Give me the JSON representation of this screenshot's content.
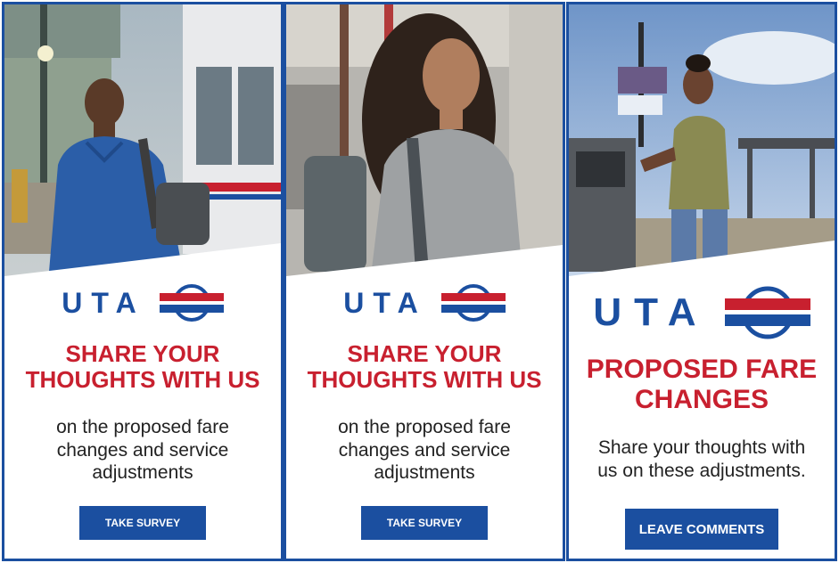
{
  "brand": {
    "logo_text": "UTA",
    "colors": {
      "blue": "#1b4fa0",
      "red": "#c8202f"
    }
  },
  "banners": [
    {
      "headline_line1": "Share your",
      "headline_line2": "thoughts with us",
      "body_line1": "on the proposed fare",
      "body_line2": "changes and service",
      "body_line3": "adjustments",
      "cta_label": "Take Survey"
    },
    {
      "headline_line1": "Share your",
      "headline_line2": "thoughts with us",
      "body_line1": "on the proposed fare",
      "body_line2": "changes and service",
      "body_line3": "adjustments",
      "cta_label": "Take Survey"
    },
    {
      "headline_line1": "Proposed fare",
      "headline_line2": "changes",
      "body_line1": "Share your thoughts with",
      "body_line2": "us on these adjustments.",
      "cta_label": "Leave Comments"
    }
  ]
}
